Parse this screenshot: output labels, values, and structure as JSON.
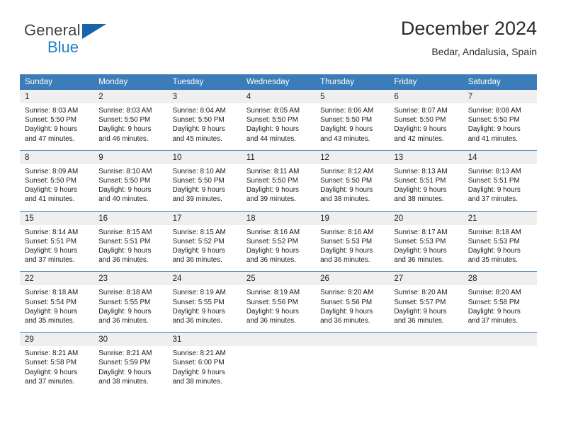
{
  "logo": {
    "line1": "General",
    "line2": "Blue",
    "triangle_color": "#1565a8",
    "text_color": "#3f3f3f",
    "blue_color": "#1a7fc1"
  },
  "header": {
    "title": "December 2024",
    "subtitle": "Bedar, Andalusia, Spain"
  },
  "theme": {
    "header_blue": "#3b7cb9",
    "daynum_gray": "#efefef",
    "text": "#1a1a1a"
  },
  "calendar": {
    "weekday_headers": [
      "Sunday",
      "Monday",
      "Tuesday",
      "Wednesday",
      "Thursday",
      "Friday",
      "Saturday"
    ],
    "weeks": [
      [
        {
          "day": "1",
          "sunrise": "Sunrise: 8:03 AM",
          "sunset": "Sunset: 5:50 PM",
          "daylight": "Daylight: 9 hours and 47 minutes."
        },
        {
          "day": "2",
          "sunrise": "Sunrise: 8:03 AM",
          "sunset": "Sunset: 5:50 PM",
          "daylight": "Daylight: 9 hours and 46 minutes."
        },
        {
          "day": "3",
          "sunrise": "Sunrise: 8:04 AM",
          "sunset": "Sunset: 5:50 PM",
          "daylight": "Daylight: 9 hours and 45 minutes."
        },
        {
          "day": "4",
          "sunrise": "Sunrise: 8:05 AM",
          "sunset": "Sunset: 5:50 PM",
          "daylight": "Daylight: 9 hours and 44 minutes."
        },
        {
          "day": "5",
          "sunrise": "Sunrise: 8:06 AM",
          "sunset": "Sunset: 5:50 PM",
          "daylight": "Daylight: 9 hours and 43 minutes."
        },
        {
          "day": "6",
          "sunrise": "Sunrise: 8:07 AM",
          "sunset": "Sunset: 5:50 PM",
          "daylight": "Daylight: 9 hours and 42 minutes."
        },
        {
          "day": "7",
          "sunrise": "Sunrise: 8:08 AM",
          "sunset": "Sunset: 5:50 PM",
          "daylight": "Daylight: 9 hours and 41 minutes."
        }
      ],
      [
        {
          "day": "8",
          "sunrise": "Sunrise: 8:09 AM",
          "sunset": "Sunset: 5:50 PM",
          "daylight": "Daylight: 9 hours and 41 minutes."
        },
        {
          "day": "9",
          "sunrise": "Sunrise: 8:10 AM",
          "sunset": "Sunset: 5:50 PM",
          "daylight": "Daylight: 9 hours and 40 minutes."
        },
        {
          "day": "10",
          "sunrise": "Sunrise: 8:10 AM",
          "sunset": "Sunset: 5:50 PM",
          "daylight": "Daylight: 9 hours and 39 minutes."
        },
        {
          "day": "11",
          "sunrise": "Sunrise: 8:11 AM",
          "sunset": "Sunset: 5:50 PM",
          "daylight": "Daylight: 9 hours and 39 minutes."
        },
        {
          "day": "12",
          "sunrise": "Sunrise: 8:12 AM",
          "sunset": "Sunset: 5:50 PM",
          "daylight": "Daylight: 9 hours and 38 minutes."
        },
        {
          "day": "13",
          "sunrise": "Sunrise: 8:13 AM",
          "sunset": "Sunset: 5:51 PM",
          "daylight": "Daylight: 9 hours and 38 minutes."
        },
        {
          "day": "14",
          "sunrise": "Sunrise: 8:13 AM",
          "sunset": "Sunset: 5:51 PM",
          "daylight": "Daylight: 9 hours and 37 minutes."
        }
      ],
      [
        {
          "day": "15",
          "sunrise": "Sunrise: 8:14 AM",
          "sunset": "Sunset: 5:51 PM",
          "daylight": "Daylight: 9 hours and 37 minutes."
        },
        {
          "day": "16",
          "sunrise": "Sunrise: 8:15 AM",
          "sunset": "Sunset: 5:51 PM",
          "daylight": "Daylight: 9 hours and 36 minutes."
        },
        {
          "day": "17",
          "sunrise": "Sunrise: 8:15 AM",
          "sunset": "Sunset: 5:52 PM",
          "daylight": "Daylight: 9 hours and 36 minutes."
        },
        {
          "day": "18",
          "sunrise": "Sunrise: 8:16 AM",
          "sunset": "Sunset: 5:52 PM",
          "daylight": "Daylight: 9 hours and 36 minutes."
        },
        {
          "day": "19",
          "sunrise": "Sunrise: 8:16 AM",
          "sunset": "Sunset: 5:53 PM",
          "daylight": "Daylight: 9 hours and 36 minutes."
        },
        {
          "day": "20",
          "sunrise": "Sunrise: 8:17 AM",
          "sunset": "Sunset: 5:53 PM",
          "daylight": "Daylight: 9 hours and 36 minutes."
        },
        {
          "day": "21",
          "sunrise": "Sunrise: 8:18 AM",
          "sunset": "Sunset: 5:53 PM",
          "daylight": "Daylight: 9 hours and 35 minutes."
        }
      ],
      [
        {
          "day": "22",
          "sunrise": "Sunrise: 8:18 AM",
          "sunset": "Sunset: 5:54 PM",
          "daylight": "Daylight: 9 hours and 35 minutes."
        },
        {
          "day": "23",
          "sunrise": "Sunrise: 8:18 AM",
          "sunset": "Sunset: 5:55 PM",
          "daylight": "Daylight: 9 hours and 36 minutes."
        },
        {
          "day": "24",
          "sunrise": "Sunrise: 8:19 AM",
          "sunset": "Sunset: 5:55 PM",
          "daylight": "Daylight: 9 hours and 36 minutes."
        },
        {
          "day": "25",
          "sunrise": "Sunrise: 8:19 AM",
          "sunset": "Sunset: 5:56 PM",
          "daylight": "Daylight: 9 hours and 36 minutes."
        },
        {
          "day": "26",
          "sunrise": "Sunrise: 8:20 AM",
          "sunset": "Sunset: 5:56 PM",
          "daylight": "Daylight: 9 hours and 36 minutes."
        },
        {
          "day": "27",
          "sunrise": "Sunrise: 8:20 AM",
          "sunset": "Sunset: 5:57 PM",
          "daylight": "Daylight: 9 hours and 36 minutes."
        },
        {
          "day": "28",
          "sunrise": "Sunrise: 8:20 AM",
          "sunset": "Sunset: 5:58 PM",
          "daylight": "Daylight: 9 hours and 37 minutes."
        }
      ],
      [
        {
          "day": "29",
          "sunrise": "Sunrise: 8:21 AM",
          "sunset": "Sunset: 5:58 PM",
          "daylight": "Daylight: 9 hours and 37 minutes."
        },
        {
          "day": "30",
          "sunrise": "Sunrise: 8:21 AM",
          "sunset": "Sunset: 5:59 PM",
          "daylight": "Daylight: 9 hours and 38 minutes."
        },
        {
          "day": "31",
          "sunrise": "Sunrise: 8:21 AM",
          "sunset": "Sunset: 6:00 PM",
          "daylight": "Daylight: 9 hours and 38 minutes."
        },
        {
          "day": "",
          "sunrise": "",
          "sunset": "",
          "daylight": ""
        },
        {
          "day": "",
          "sunrise": "",
          "sunset": "",
          "daylight": ""
        },
        {
          "day": "",
          "sunrise": "",
          "sunset": "",
          "daylight": ""
        },
        {
          "day": "",
          "sunrise": "",
          "sunset": "",
          "daylight": ""
        }
      ]
    ]
  }
}
